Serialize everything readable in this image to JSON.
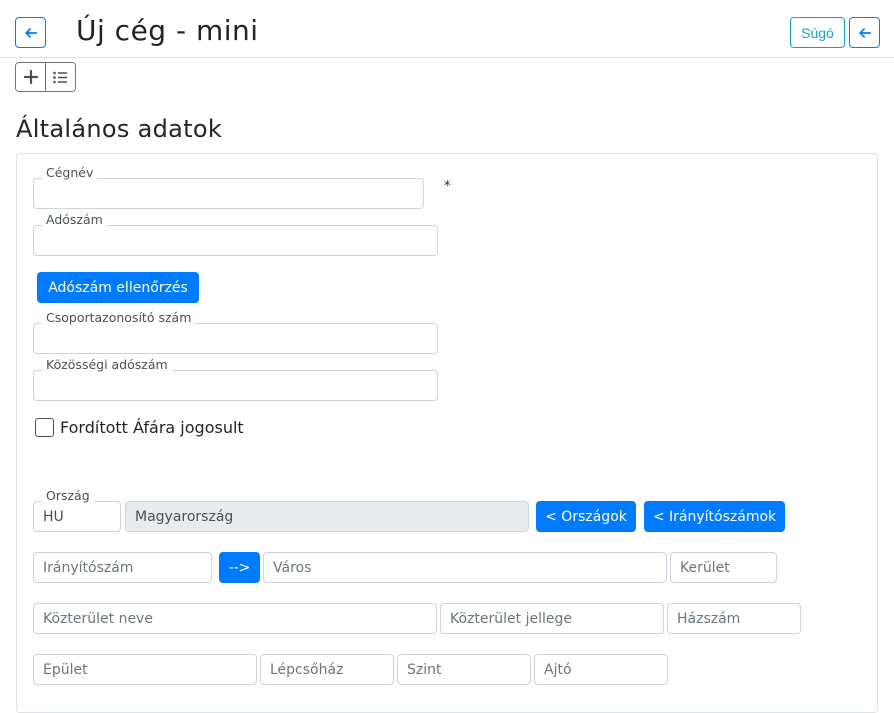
{
  "header": {
    "title": "Új cég - mini",
    "back_icon": "arrow-left-icon",
    "help_label": "Súgó"
  },
  "toolbar": {
    "add_icon": "plus-icon",
    "list_icon": "list-icon"
  },
  "section": {
    "title": "Általános adatok"
  },
  "form": {
    "company_name": {
      "label": "Cégnév",
      "value": "",
      "required_mark": "*"
    },
    "tax_number": {
      "label": "Adószám",
      "value": ""
    },
    "tax_check_button": "Adószám ellenőrzés",
    "group_id": {
      "label": "Csoportazonosító szám",
      "value": ""
    },
    "eu_tax_number": {
      "label": "Közösségi adószám",
      "value": ""
    },
    "reverse_vat": {
      "label": "Fordított Áfára jogosult",
      "checked": false
    },
    "country": {
      "label": "Ország",
      "code": "HU",
      "name": "Magyarország"
    },
    "countries_button": "< Országok",
    "zipcodes_button": "< Irányítószámok",
    "zip": {
      "placeholder": "Irányítószám"
    },
    "zip_arrow_button": "-->",
    "city": {
      "placeholder": "Város"
    },
    "district": {
      "placeholder": "Kerület"
    },
    "street_name": {
      "placeholder": "Közterület neve"
    },
    "street_type": {
      "placeholder": "Közterület jellege"
    },
    "house_number": {
      "placeholder": "Házszám"
    },
    "building": {
      "placeholder": "Épület"
    },
    "staircase": {
      "placeholder": "Lépcsőház"
    },
    "floor": {
      "placeholder": "Szint"
    },
    "door": {
      "placeholder": "Ajtó"
    }
  },
  "colors": {
    "primary": "#007bff",
    "info": "#17a2b8"
  }
}
